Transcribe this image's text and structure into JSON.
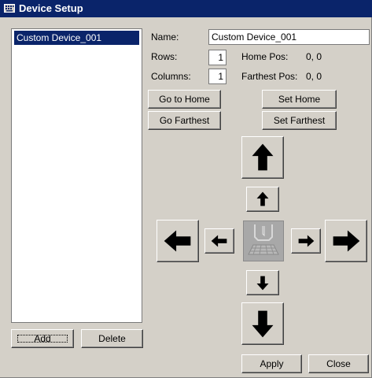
{
  "window": {
    "title": "Device Setup",
    "title_icon": "keyboard-icon"
  },
  "device_list": {
    "items": [
      "Custom Device_001"
    ],
    "selected_index": 0
  },
  "list_buttons": {
    "add": "Add",
    "delete": "Delete"
  },
  "properties": {
    "name_label": "Name:",
    "name_value": "Custom Device_001",
    "rows_label": "Rows:",
    "rows_value": "1",
    "columns_label": "Columns:",
    "columns_value": "1",
    "home_pos_label": "Home Pos:",
    "home_pos_value": "0, 0",
    "farthest_pos_label": "Farthest Pos:",
    "farthest_pos_value": "0, 0"
  },
  "position_buttons": {
    "go_home": "Go to Home",
    "set_home": "Set Home",
    "go_farthest": "Go Farthest",
    "set_farthest": "Set Farthest"
  },
  "direction_pad": {
    "buttons": [
      "up-large",
      "up-small",
      "left-large",
      "left-small",
      "right-small",
      "right-large",
      "down-small",
      "down-large"
    ],
    "center_icon": "device-plate-icon"
  },
  "footer": {
    "apply": "Apply",
    "close": "Close"
  }
}
